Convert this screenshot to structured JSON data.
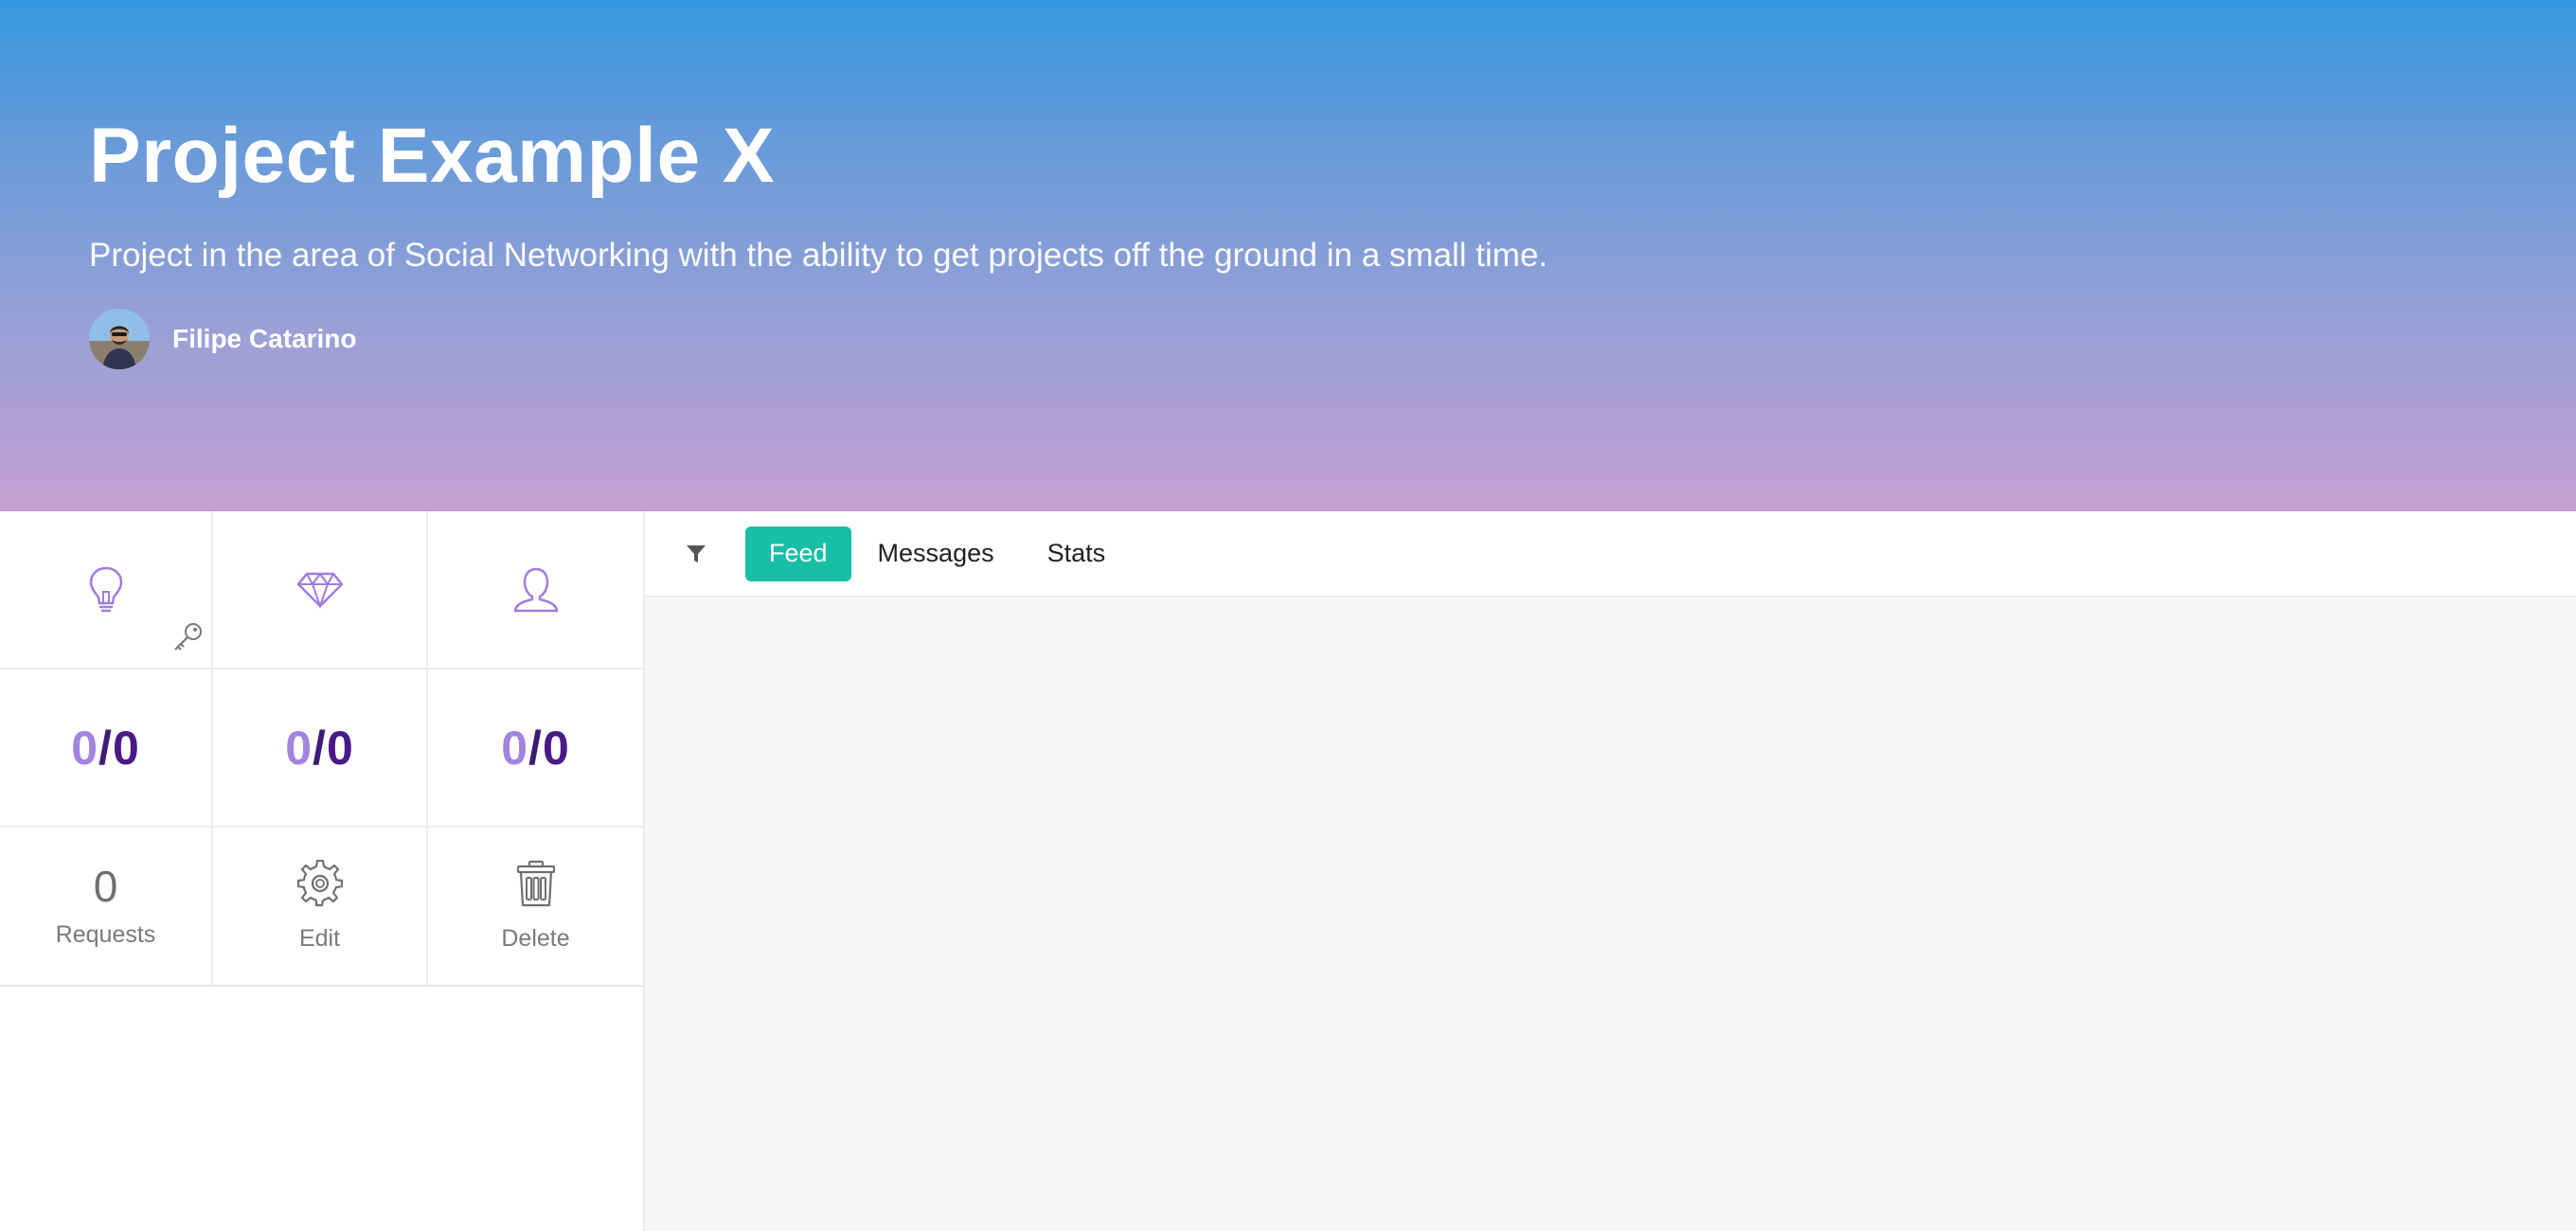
{
  "project": {
    "title": "Project Example X",
    "description": "Project in the area of Social Networking with the ability to get projects off the ground in a small time.",
    "author": "Filipe Catarino"
  },
  "stats": {
    "ideas": {
      "icon": "lightbulb-icon",
      "current": "0",
      "total": "0"
    },
    "value": {
      "icon": "diamond-icon",
      "current": "0",
      "total": "0"
    },
    "members": {
      "icon": "user-icon",
      "current": "0",
      "total": "0"
    },
    "separator": "/"
  },
  "actions": {
    "requests_count": "0",
    "requests_label": "Requests",
    "edit_label": "Edit",
    "delete_label": "Delete"
  },
  "tabs": {
    "filter_icon": "filter-icon",
    "items": [
      {
        "label": "Feed",
        "active": true
      },
      {
        "label": "Messages",
        "active": false
      },
      {
        "label": "Stats",
        "active": false
      }
    ]
  },
  "colors": {
    "accent_tab": "#17bfa7",
    "ratio_light": "#a384e0",
    "ratio_dark": "#4a1a86",
    "icon_purple": "#a07ce0",
    "hero_top": "#3698df",
    "hero_bottom": "#c5a0d2"
  }
}
